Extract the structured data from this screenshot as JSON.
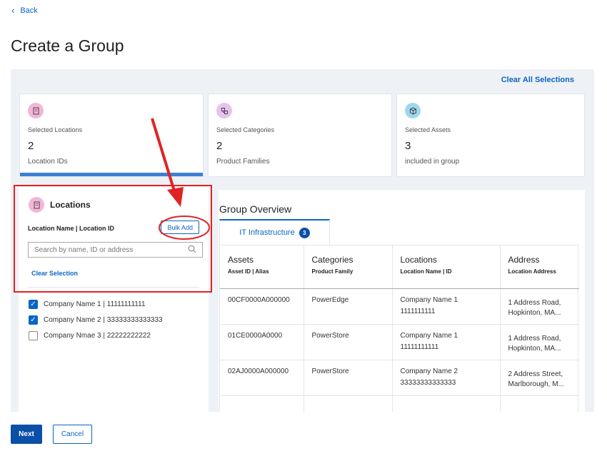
{
  "nav": {
    "back_label": "Back"
  },
  "page": {
    "title": "Create a Group",
    "clear_all_label": "Clear All Selections"
  },
  "summary_cards": [
    {
      "label": "Selected Locations",
      "value": "2",
      "sub": "Location IDs",
      "icon": "building-icon"
    },
    {
      "label": "Selected Categories",
      "value": "2",
      "sub": "Product Families",
      "icon": "category-icon"
    },
    {
      "label": "Selected Assets",
      "value": "3",
      "sub": "included in group",
      "icon": "cube-icon"
    }
  ],
  "locations": {
    "title": "Locations",
    "subtitle": "Location Name | Location ID",
    "bulk_add_label": "Bulk Add",
    "search_placeholder": "Search by name, ID or address",
    "clear_selection_label": "Clear Selection",
    "items": [
      {
        "label": "Company Name 1 | 11111111111",
        "checked": true
      },
      {
        "label": "Company Name 2 | 33333333333333",
        "checked": true
      },
      {
        "label": "Company Nmae 3 | 22222222222",
        "checked": false
      }
    ]
  },
  "overview": {
    "title": "Group Overview",
    "tab_label": "IT Infrastructure",
    "tab_count": "3",
    "columns": [
      {
        "title": "Assets",
        "sub": "Asset ID | Alias"
      },
      {
        "title": "Categories",
        "sub": "Product Family"
      },
      {
        "title": "Locations",
        "sub": "Location Name | ID"
      },
      {
        "title": "Address",
        "sub": "Location Address"
      }
    ],
    "rows": [
      {
        "asset": "00CF0000A000000",
        "category": "PowerEdge",
        "loc_name": "Company Name 1",
        "loc_id": "1111111111",
        "addr1": "1 Address Road,",
        "addr2": "Hopkinton, MA..."
      },
      {
        "asset": "01CE0000A0000",
        "category": "PowerStore",
        "loc_name": "Company Name 1",
        "loc_id": "11111111111",
        "addr1": "1 Address Road,",
        "addr2": "Hopkinton, MA..."
      },
      {
        "asset": "02AJ0000A000000",
        "category": "PowerStore",
        "loc_name": "Company Name 2",
        "loc_id": "33333333333333",
        "addr1": "2 Address Street,",
        "addr2": "Marlborough, M..."
      }
    ]
  },
  "footer": {
    "next_label": "Next",
    "cancel_label": "Cancel"
  },
  "colors": {
    "accent": "#0b66c3",
    "primary_button": "#0b4fa8",
    "annotation": "#e02424",
    "panel_bg": "#eef1f5"
  }
}
